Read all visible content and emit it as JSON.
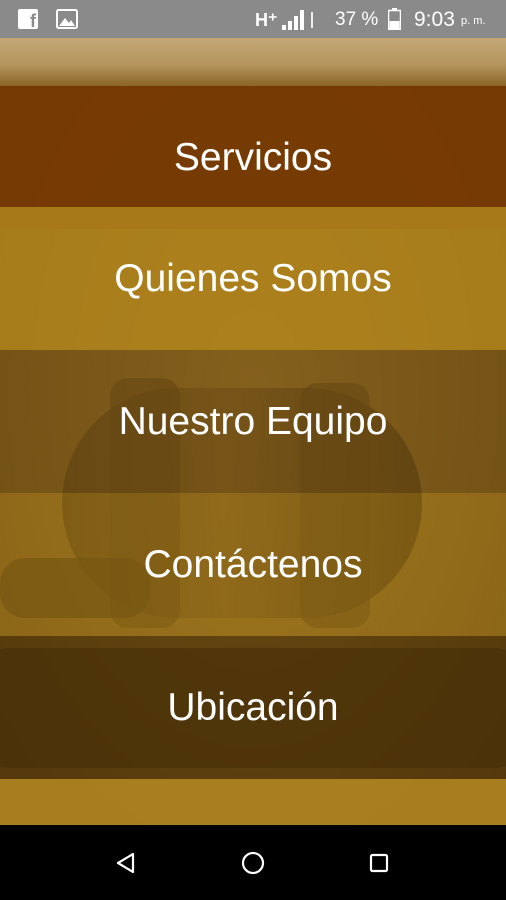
{
  "status_bar": {
    "facebook_icon": "facebook-icon",
    "facebook_glyph": "f",
    "gallery_icon": "image-icon",
    "network_type": "H⁺",
    "signal_icon": "signal-bars-icon",
    "battery_percent": "37 %",
    "battery_icon": "battery-icon",
    "time": "9:03",
    "time_suffix": "p. m."
  },
  "menu": {
    "items": [
      {
        "label": "Servicios"
      },
      {
        "label": "Quienes Somos"
      },
      {
        "label": "Nuestro Equipo"
      },
      {
        "label": "Contáctenos"
      },
      {
        "label": "Ubicación"
      }
    ]
  },
  "nav_bar": {
    "back_icon": "back-triangle-icon",
    "home_icon": "home-circle-icon",
    "recent_icon": "recent-apps-square-icon"
  },
  "colors": {
    "status_bar_bg": "#8a8a8a",
    "menu_servicios": "#763a02",
    "menu_gold": "#b0841c",
    "menu_dark_gold": "#78561a",
    "text": "#ffffff",
    "nav_bar_bg": "#000000"
  }
}
